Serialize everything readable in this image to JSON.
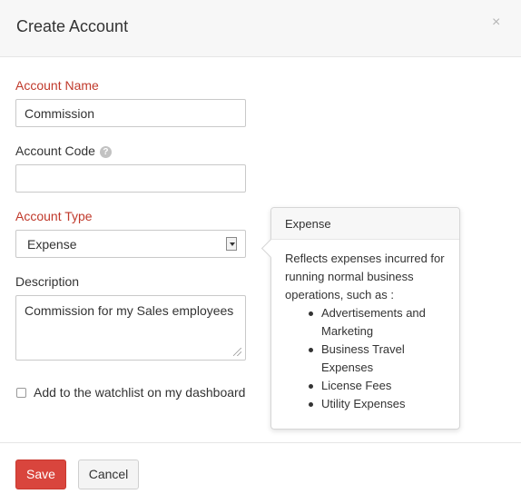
{
  "dialog": {
    "title": "Create Account",
    "close_glyph": "×"
  },
  "form": {
    "account_name": {
      "label": "Account Name",
      "value": "Commission",
      "required": true
    },
    "account_code": {
      "label": "Account Code",
      "value": "",
      "help_glyph": "?"
    },
    "account_type": {
      "label": "Account Type",
      "value": "Expense",
      "required": true
    },
    "description": {
      "label": "Description",
      "value": "Commission for my Sales employees"
    },
    "watchlist": {
      "label": "Add to the watchlist on my dashboard",
      "checked": false
    }
  },
  "popover": {
    "title": "Expense",
    "intro": "Reflects expenses incurred for running normal business operations, such as :",
    "items": [
      "Advertisements and Marketing",
      "Business Travel Expenses",
      "License Fees",
      "Utility Expenses"
    ]
  },
  "footer": {
    "save_label": "Save",
    "cancel_label": "Cancel"
  },
  "colors": {
    "required_label": "#c0392b",
    "save_button": "#d9453d"
  },
  "icons": {
    "close": "close-icon",
    "help": "help-icon",
    "dropdown": "chevron-down-icon",
    "resize": "resize-grip-icon"
  }
}
